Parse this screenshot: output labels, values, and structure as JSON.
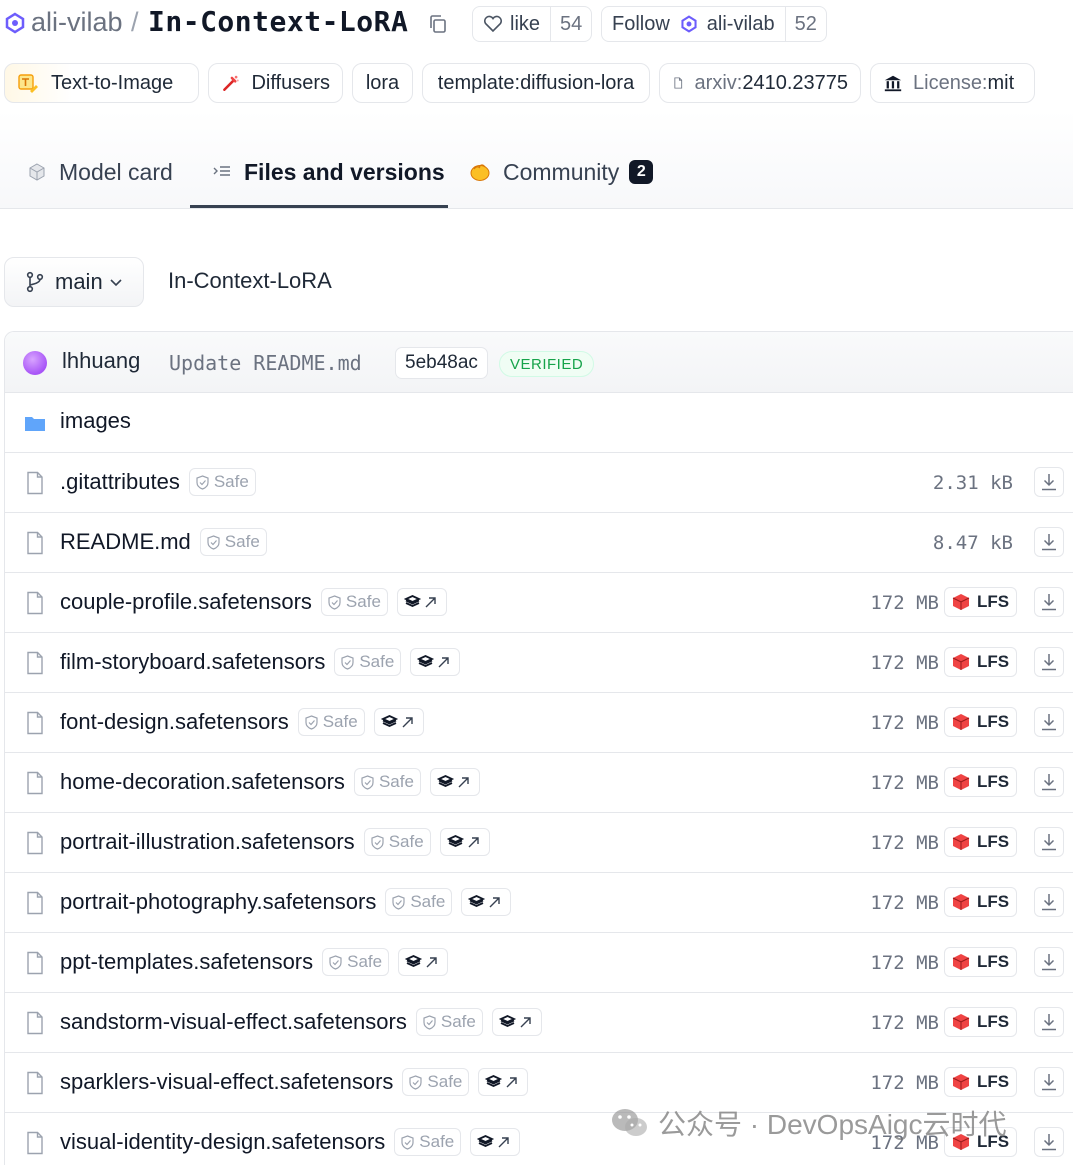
{
  "header": {
    "org": "ali-vilab",
    "separator": "/",
    "repo": "In-Context-LoRA",
    "like_label": "like",
    "like_count": "54",
    "follow_label": "Follow",
    "follow_org": "ali-vilab",
    "follow_count": "52"
  },
  "tags": [
    {
      "label": "Text-to-Image",
      "icon": "text-to-image-icon"
    },
    {
      "label": "Diffusers",
      "icon": "diffusers-icon"
    },
    {
      "label": "lora"
    },
    {
      "label": "template:diffusion-lora"
    },
    {
      "prefix": "arxiv:",
      "label": "2410.23775",
      "icon": "paper-icon"
    },
    {
      "prefix": "License: ",
      "label": "mit",
      "icon": "bank-icon"
    }
  ],
  "tabs": [
    {
      "label": "Model card",
      "icon": "cube-icon"
    },
    {
      "label": "Files and versions",
      "icon": "files-list-icon",
      "active": true
    },
    {
      "label": "Community",
      "icon": "hand-wave-icon",
      "badge": "2"
    }
  ],
  "branch": {
    "name": "main",
    "path": "In-Context-LoRA"
  },
  "commit": {
    "user": "lhhuang",
    "message": "Update README.md",
    "hash": "5eb48ac",
    "status": "VERIFIED"
  },
  "files": [
    {
      "name": "images",
      "type": "folder"
    },
    {
      "name": ".gitattributes",
      "type": "file",
      "safe": "Safe",
      "size": "2.31 kB"
    },
    {
      "name": "README.md",
      "type": "file",
      "safe": "Safe",
      "size": "8.47 kB"
    },
    {
      "name": "couple-profile.safetensors",
      "type": "file",
      "safe": "Safe",
      "pickle": true,
      "size": "172 MB",
      "lfs": "LFS"
    },
    {
      "name": "film-storyboard.safetensors",
      "type": "file",
      "safe": "Safe",
      "pickle": true,
      "size": "172 MB",
      "lfs": "LFS"
    },
    {
      "name": "font-design.safetensors",
      "type": "file",
      "safe": "Safe",
      "pickle": true,
      "size": "172 MB",
      "lfs": "LFS"
    },
    {
      "name": "home-decoration.safetensors",
      "type": "file",
      "safe": "Safe",
      "pickle": true,
      "size": "172 MB",
      "lfs": "LFS"
    },
    {
      "name": "portrait-illustration.safetensors",
      "type": "file",
      "safe": "Safe",
      "pickle": true,
      "size": "172 MB",
      "lfs": "LFS"
    },
    {
      "name": "portrait-photography.safetensors",
      "type": "file",
      "safe": "Safe",
      "pickle": true,
      "size": "172 MB",
      "lfs": "LFS"
    },
    {
      "name": "ppt-templates.safetensors",
      "type": "file",
      "safe": "Safe",
      "pickle": true,
      "size": "172 MB",
      "lfs": "LFS"
    },
    {
      "name": "sandstorm-visual-effect.safetensors",
      "type": "file",
      "safe": "Safe",
      "pickle": true,
      "size": "172 MB",
      "lfs": "LFS"
    },
    {
      "name": "sparklers-visual-effect.safetensors",
      "type": "file",
      "safe": "Safe",
      "pickle": true,
      "size": "172 MB",
      "lfs": "LFS"
    },
    {
      "name": "visual-identity-design.safetensors",
      "type": "file",
      "safe": "Safe",
      "pickle": true,
      "size": "172 MB",
      "lfs": "LFS"
    }
  ],
  "watermark": "公众号 · DevOpsAigc云时代",
  "colors": {
    "accent_verified": "#16a34a",
    "lfs_red": "#dc2626",
    "folder_blue": "#60a5fa",
    "avatar_purple": "#a855f7"
  }
}
